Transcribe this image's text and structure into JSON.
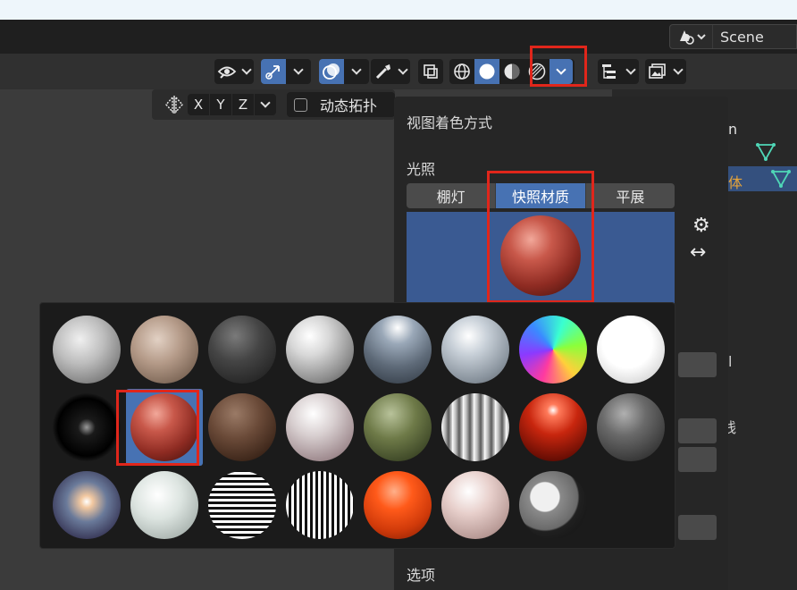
{
  "topbar": {
    "scene_label": "Scene"
  },
  "subheader": {
    "axes": [
      "X",
      "Y",
      "Z"
    ],
    "topology_label": "动态拓扑"
  },
  "shading_panel": {
    "title": "视图着色方式",
    "lighting_title": "光照",
    "tabs": [
      {
        "label": "棚灯",
        "active": false
      },
      {
        "label": "快照材质",
        "active": true
      },
      {
        "label": "平展",
        "active": false
      }
    ],
    "options_title": "选项"
  },
  "outliner": {
    "partial_text_1": "n",
    "partial_text_2": "体",
    "partial_text_3": "l",
    "partial_text_4": "线"
  },
  "matcaps": {
    "selected_index": 9,
    "count": 23
  },
  "colors": {
    "accent": "#4772b3",
    "highlight_box": "#e0261b",
    "panel_bg": "#262626",
    "outliner_orange": "#e5a33a",
    "mesh_icon": "#4fd6b6"
  },
  "icons": [
    "scene-icon",
    "visibility-eye-icon",
    "gizmo-icon",
    "overlay-icon",
    "xray-icon",
    "wireframe-shading-icon",
    "solid-shading-icon",
    "material-shading-icon",
    "rendered-shading-icon",
    "gear-icon",
    "flip-arrow-icon",
    "mirror-icon",
    "filter-icon",
    "image-icon",
    "mesh-icon"
  ]
}
